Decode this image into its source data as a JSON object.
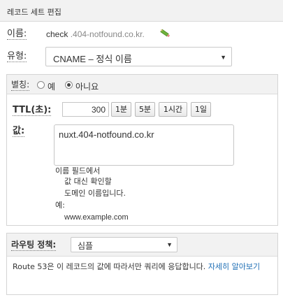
{
  "header": {
    "title": "레코드 세트 편집"
  },
  "name": {
    "label": "이름:",
    "value": "check",
    "suffix": ".404-notfound.co.kr."
  },
  "type": {
    "label": "유형:",
    "selected": "CNAME – 정식 이름"
  },
  "alias": {
    "label": "별칭:",
    "yes": "예",
    "no": "아니요",
    "selected": "no"
  },
  "ttl": {
    "label": "TTL(초):",
    "value": "300",
    "buttons": [
      "1분",
      "5분",
      "1시간",
      "1일"
    ]
  },
  "value_field": {
    "label": "값:",
    "content": "nuxt.404-notfound.co.kr",
    "help": [
      "이름 필드에서",
      "값 대신 확인할",
      "도메인 이름입니다.",
      "예:",
      "www.example.com"
    ]
  },
  "routing": {
    "label": "라우팅 정책:",
    "selected": "심플",
    "description": "Route 53은 이 레코드의 값에 따라서만 쿼리에 응답합니다.",
    "learn_more": "자세히 알아보기"
  }
}
